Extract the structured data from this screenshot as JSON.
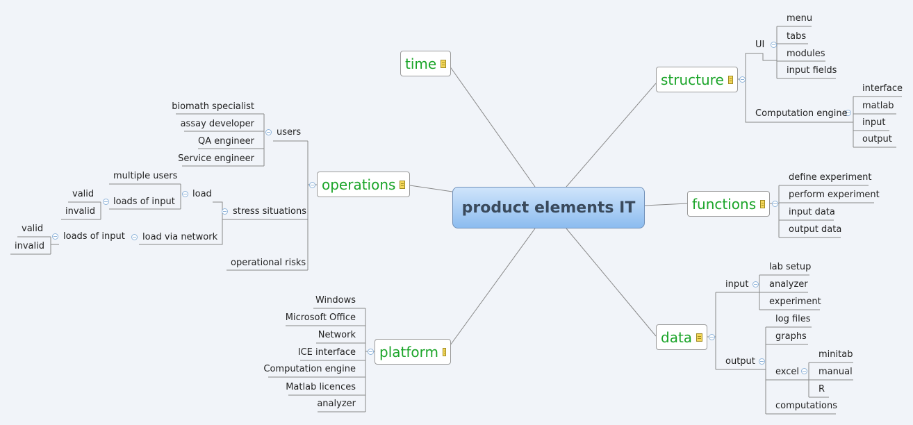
{
  "root": {
    "title": "product elements IT"
  },
  "topics": {
    "time": "time",
    "structure": "structure",
    "functions": "functions",
    "data": "data",
    "platform": "platform",
    "operations": "operations"
  },
  "structure": {
    "ui": "UI",
    "ui_items": [
      "menu",
      "tabs",
      "modules",
      "input fields"
    ],
    "engine": "Computation engine",
    "engine_items": [
      "interface",
      "matlab",
      "input",
      "output"
    ]
  },
  "functions": {
    "items": [
      "define experiment",
      "perform experiment",
      "input data",
      "output data"
    ]
  },
  "data": {
    "input": "input",
    "input_items": [
      "lab setup",
      "analyzer",
      "experiment"
    ],
    "output": "output",
    "output_items": [
      "log files",
      "graphs",
      "excel",
      "computations"
    ],
    "excel_items": [
      "minitab",
      "manual",
      "R"
    ]
  },
  "platform": {
    "items": [
      "Windows",
      "Microsoft Office",
      "Network",
      "ICE interface",
      "Computation engine",
      "Matlab licences",
      "analyzer"
    ]
  },
  "operations": {
    "users": "users",
    "user_items": [
      "biomath specialist",
      "assay developer",
      "QA engineer",
      "Service engineer"
    ],
    "stress": "stress situations",
    "load": "load",
    "multiple_users": "multiple users",
    "loads_of_input": "loads of input",
    "load_valid": "valid",
    "load_invalid": "invalid",
    "load_via_network": "load via network",
    "net_loads_of_input": "loads of input",
    "net_valid": "valid",
    "net_invalid": "invalid",
    "risks": "operational risks"
  },
  "colors": {
    "topic_text": "#1aa428",
    "root_text": "#3a4a5c",
    "background": "#f1f4f9"
  }
}
